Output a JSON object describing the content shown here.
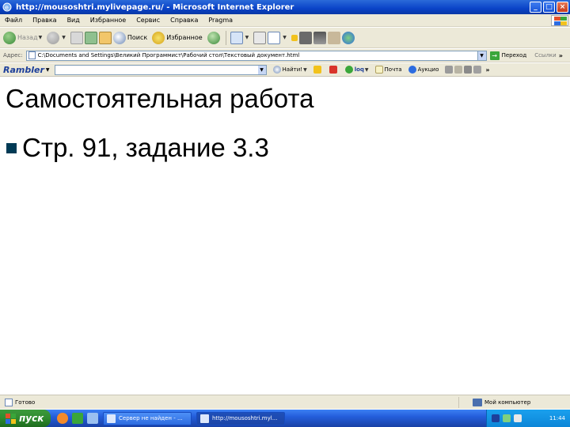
{
  "window": {
    "title": "http://mousoshtri.mylivepage.ru/ - Microsoft Internet Explorer",
    "minimize_glyph": "_",
    "maximize_glyph": "□",
    "close_glyph": "×"
  },
  "menu": {
    "items": [
      "Файл",
      "Правка",
      "Вид",
      "Избранное",
      "Сервис",
      "Справка",
      "Pragma"
    ]
  },
  "toolbar": {
    "back_label": "Назад",
    "search_label": "Поиск",
    "favorites_label": "Избранное"
  },
  "address": {
    "label": "Адрес:",
    "value": "C:\\Documents and Settings\\Великий Программист\\Рабочий стол\\Текстовый документ.html",
    "go_label": "Переход",
    "links_label": "Ссылки",
    "more": "»"
  },
  "rambler": {
    "logo": "Rambler",
    "find_label": "Найти!",
    "loq_label": "loq",
    "mail_label": "Почта",
    "auction_label": "Аукцио",
    "more": "»"
  },
  "content": {
    "title": "Самостоятельная работа",
    "bullet": "Стр. 91, задание 3.3"
  },
  "status": {
    "left_text": "Готово",
    "zone_text": "Мой компьютер"
  },
  "taskbar": {
    "start_label": "пуск",
    "tasks": [
      {
        "label": "Сервер не найден - ..."
      },
      {
        "label": "http://mousoshtri.myl..."
      }
    ],
    "clock": "11:44"
  },
  "colors": {
    "titlebar": "#0a43c8",
    "bullet": "#003a55",
    "start": "#2f8a2f",
    "tray": "#0c86d8"
  }
}
